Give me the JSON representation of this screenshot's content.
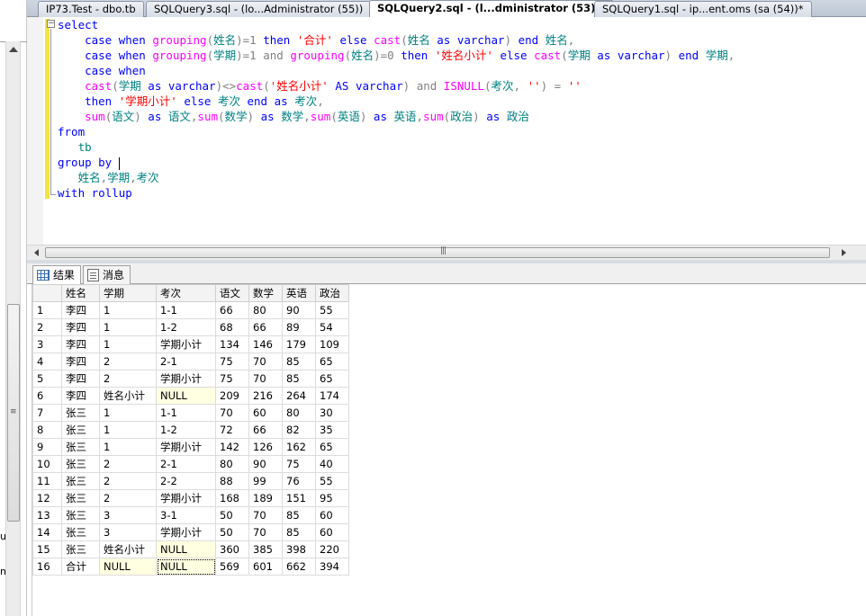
{
  "tabs": [
    {
      "label": "IP73.Test - dbo.tb",
      "active": false
    },
    {
      "label": "SQLQuery3.sql - (lo...Administrator (55))",
      "active": false
    },
    {
      "label": "SQLQuery2.sql - (l...dministrator (53))*",
      "active": true
    },
    {
      "label": "SQLQuery1.sql - ip...ent.oms (sa (54))*",
      "active": false
    }
  ],
  "editor": {
    "lines": [
      [
        [
          "kw",
          "select"
        ]
      ],
      [
        [
          "kw",
          "    case when "
        ],
        [
          "fn",
          "grouping"
        ],
        [
          "op",
          "("
        ],
        [
          "id",
          "姓名"
        ],
        [
          "op",
          ")=1 "
        ],
        [
          "kw",
          "then "
        ],
        [
          "str",
          "'合计'"
        ],
        [
          "kw",
          " else "
        ],
        [
          "fn",
          "cast"
        ],
        [
          "op",
          "("
        ],
        [
          "id",
          "姓名"
        ],
        [
          "kw",
          " as varchar"
        ],
        [
          "op",
          ")"
        ],
        [
          "kw",
          " end "
        ],
        [
          "id",
          "姓名"
        ],
        [
          "op",
          ","
        ]
      ],
      [
        [
          "kw",
          "    case when "
        ],
        [
          "fn",
          "grouping"
        ],
        [
          "op",
          "("
        ],
        [
          "id",
          "学期"
        ],
        [
          "op",
          ")=1 "
        ],
        [
          "op",
          "and "
        ],
        [
          "fn",
          "grouping"
        ],
        [
          "op",
          "("
        ],
        [
          "id",
          "姓名"
        ],
        [
          "op",
          ")=0 "
        ],
        [
          "kw",
          "then "
        ],
        [
          "str",
          "'姓名小计'"
        ],
        [
          "kw",
          " else "
        ],
        [
          "fn",
          "cast"
        ],
        [
          "op",
          "("
        ],
        [
          "id",
          "学期"
        ],
        [
          "kw",
          " as varchar"
        ],
        [
          "op",
          ")"
        ],
        [
          "kw",
          " end "
        ],
        [
          "id",
          "学期"
        ],
        [
          "op",
          ","
        ]
      ],
      [
        [
          "kw",
          "    case when"
        ]
      ],
      [
        [
          "fn",
          "    cast"
        ],
        [
          "op",
          "("
        ],
        [
          "id",
          "学期"
        ],
        [
          "kw",
          " as varchar"
        ],
        [
          "op",
          ")<>"
        ],
        [
          "fn",
          "cast"
        ],
        [
          "op",
          "("
        ],
        [
          "str",
          "'姓名小计'"
        ],
        [
          "kw",
          " AS varchar"
        ],
        [
          "op",
          ") and "
        ],
        [
          "fn",
          "ISNULL"
        ],
        [
          "op",
          "("
        ],
        [
          "id",
          "考次"
        ],
        [
          "op",
          ", "
        ],
        [
          "str",
          "''"
        ],
        [
          "op",
          ") = "
        ],
        [
          "str",
          "''"
        ]
      ],
      [
        [
          "kw",
          "    then "
        ],
        [
          "str",
          "'学期小计'"
        ],
        [
          "kw",
          " else "
        ],
        [
          "id",
          "考次"
        ],
        [
          "kw",
          " end as "
        ],
        [
          "id",
          "考次"
        ],
        [
          "op",
          ","
        ]
      ],
      [
        [
          "fn",
          "    sum"
        ],
        [
          "op",
          "("
        ],
        [
          "id",
          "语文"
        ],
        [
          "op",
          ")"
        ],
        [
          "kw",
          " as "
        ],
        [
          "id",
          "语文"
        ],
        [
          "op",
          ","
        ],
        [
          "fn",
          "sum"
        ],
        [
          "op",
          "("
        ],
        [
          "id",
          "数学"
        ],
        [
          "op",
          ")"
        ],
        [
          "kw",
          " as "
        ],
        [
          "id",
          "数学"
        ],
        [
          "op",
          ","
        ],
        [
          "fn",
          "sum"
        ],
        [
          "op",
          "("
        ],
        [
          "id",
          "英语"
        ],
        [
          "op",
          ")"
        ],
        [
          "kw",
          " as "
        ],
        [
          "id",
          "英语"
        ],
        [
          "op",
          ","
        ],
        [
          "fn",
          "sum"
        ],
        [
          "op",
          "("
        ],
        [
          "id",
          "政治"
        ],
        [
          "op",
          ")"
        ],
        [
          "kw",
          " as "
        ],
        [
          "id",
          "政治"
        ]
      ],
      [
        [
          "kw",
          "from"
        ]
      ],
      [
        [
          "id",
          "   tb"
        ]
      ],
      [
        [
          "kw",
          "group by "
        ]
      ],
      [
        [
          "id",
          "   姓名"
        ],
        [
          "op",
          ","
        ],
        [
          "id",
          "学期"
        ],
        [
          "op",
          ","
        ],
        [
          "id",
          "考次"
        ]
      ],
      [
        [
          "kw",
          "with rollup"
        ]
      ]
    ]
  },
  "results_tabs": [
    {
      "label": "结果",
      "icon": "grid-icon",
      "active": true
    },
    {
      "label": "消息",
      "icon": "message-icon",
      "active": false
    }
  ],
  "results": {
    "columns": [
      "",
      "姓名",
      "学期",
      "考次",
      "语文",
      "数学",
      "英语",
      "政治"
    ],
    "rows": [
      [
        "1",
        "李四",
        "1",
        "1-1",
        "66",
        "80",
        "90",
        "55"
      ],
      [
        "2",
        "李四",
        "1",
        "1-2",
        "68",
        "66",
        "89",
        "54"
      ],
      [
        "3",
        "李四",
        "1",
        "学期小计",
        "134",
        "146",
        "179",
        "109"
      ],
      [
        "4",
        "李四",
        "2",
        "2-1",
        "75",
        "70",
        "85",
        "65"
      ],
      [
        "5",
        "李四",
        "2",
        "学期小计",
        "75",
        "70",
        "85",
        "65"
      ],
      [
        "6",
        "李四",
        "姓名小计",
        "NULL",
        "209",
        "216",
        "264",
        "174"
      ],
      [
        "7",
        "张三",
        "1",
        "1-1",
        "70",
        "60",
        "80",
        "30"
      ],
      [
        "8",
        "张三",
        "1",
        "1-2",
        "72",
        "66",
        "82",
        "35"
      ],
      [
        "9",
        "张三",
        "1",
        "学期小计",
        "142",
        "126",
        "162",
        "65"
      ],
      [
        "10",
        "张三",
        "2",
        "2-1",
        "80",
        "90",
        "75",
        "40"
      ],
      [
        "11",
        "张三",
        "2",
        "2-2",
        "88",
        "99",
        "76",
        "55"
      ],
      [
        "12",
        "张三",
        "2",
        "学期小计",
        "168",
        "189",
        "151",
        "95"
      ],
      [
        "13",
        "张三",
        "3",
        "3-1",
        "50",
        "70",
        "85",
        "60"
      ],
      [
        "14",
        "张三",
        "3",
        "学期小计",
        "50",
        "70",
        "85",
        "60"
      ],
      [
        "15",
        "张三",
        "姓名小计",
        "NULL",
        "360",
        "385",
        "398",
        "220"
      ],
      [
        "16",
        "合计",
        "NULL",
        "NULL",
        "569",
        "601",
        "662",
        "394"
      ]
    ]
  },
  "left_strip": {
    "glyph_u": "u",
    "glyph_n": "n"
  }
}
